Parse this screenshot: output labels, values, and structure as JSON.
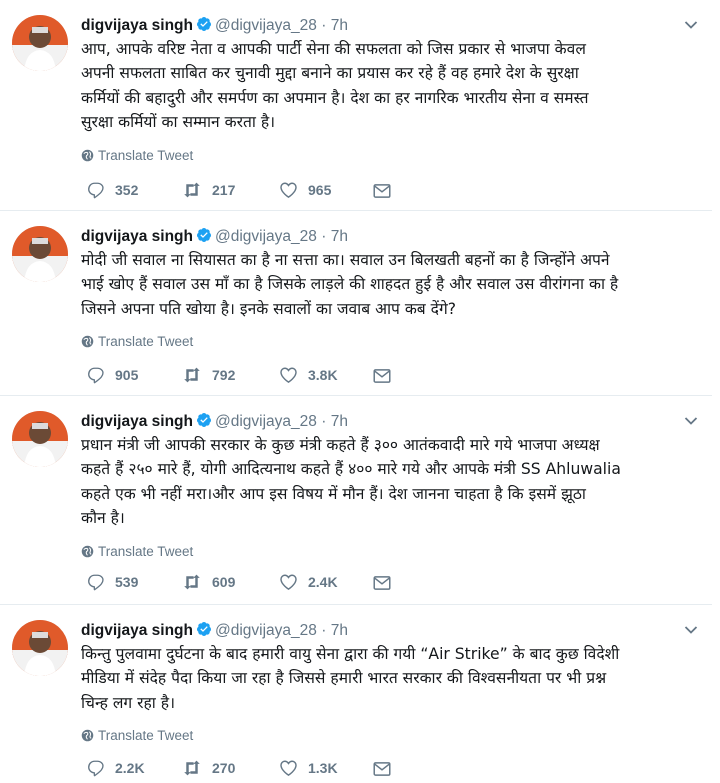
{
  "tweets": [
    {
      "name": "digvijaya singh",
      "handle": "@digvijaya_28",
      "time": "7h",
      "text": "आप, आपके वरिष्ट नेता व आपकी पार्टी सेना की सफलता को जिस प्रकार से भाजपा केवल\nअपनी सफलता साबित कर चुनावी मुद्दा बनाने का प्रयास कर रहे हैं वह हमारे देश के सुरक्षा\nकर्मियों की बहादुरी और समर्पण का अपमान है। देश का हर नागरिक भारतीय सेना व समस्त\nसुरक्षा कर्मियों का सम्मान करता है।",
      "translate": "Translate Tweet",
      "replies": "352",
      "retweets": "217",
      "likes": "965"
    },
    {
      "name": "digvijaya singh",
      "handle": "@digvijaya_28",
      "time": "7h",
      "text": "मोदी जी सवाल ना सियासत का है ना सत्ता का। सवाल उन बिलखती बहनों का है जिन्होंने अपने\nभाई खोए हैं सवाल उस माँ का है जिसके लाड़ले की शाहदत हुई है और सवाल उस वीरांगना का है\nजिसने अपना पति खोया है। इनके सवालों का जवाब आप कब देंगे?",
      "translate": "Translate Tweet",
      "replies": "905",
      "retweets": "792",
      "likes": "3.8K"
    },
    {
      "name": "digvijaya singh",
      "handle": "@digvijaya_28",
      "time": "7h",
      "text": "प्रधान मंत्री जी आपकी सरकार के कुछ मंत्री कहते हैं ३०० आतंकवादी मारे गये भाजपा अध्यक्ष\nकहते हैं २५० मारे हैं, योगी आदित्यनाथ कहते हैं ४०० मारे गये और आपके मंत्री SS Ahluwalia\nकहते एक भी नहीं मरा।और आप इस विषय में मौन हैं। देश जानना चाहता है कि इसमें झूठा\nकौन है।",
      "translate": "Translate Tweet",
      "replies": "539",
      "retweets": "609",
      "likes": "2.4K"
    },
    {
      "name": "digvijaya singh",
      "handle": "@digvijaya_28",
      "time": "7h",
      "text": "किन्तु पुलवामा दुर्घटना के बाद हमारी वायु सेना द्वारा की गयी “Air Strike” के बाद कुछ विदेशी\nमीडिया में संदेह पैदा किया जा रहा है जिससे हमारी भारत सरकार की  विश्वसनीयता पर भी प्रश्न\nचिन्ह लग रहा है।",
      "translate": "Translate Tweet",
      "replies": "2.2K",
      "retweets": "270",
      "likes": "1.3K"
    }
  ],
  "separator": "·",
  "colors": {
    "text": "#14171a",
    "secondary": "#657786",
    "verified": "#1da1f2",
    "border": "#e6ecf0"
  },
  "icons": [
    "verified-badge-icon",
    "chevron-down-icon",
    "globe-icon",
    "reply-icon",
    "retweet-icon",
    "like-icon",
    "message-icon"
  ]
}
